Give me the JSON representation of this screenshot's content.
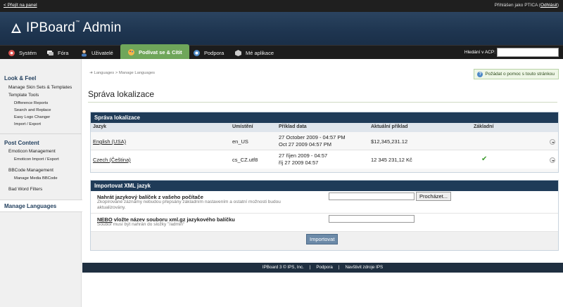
{
  "topbar": {
    "back_link": "< Přejít na panel",
    "login_prefix": "Přihlášen jako PTICA (",
    "logout": "Odhlásit",
    "login_suffix": ")"
  },
  "header": {
    "logo_text": "IPBoard",
    "logo_sup": "™",
    "logo_text2": " Admin"
  },
  "nav": {
    "items": [
      {
        "label": "Systém",
        "icon": "system-icon"
      },
      {
        "label": "Fóra",
        "icon": "forums-icon"
      },
      {
        "label": "Uživatelé",
        "icon": "users-icon"
      },
      {
        "label": "Podívat se & Cítit",
        "icon": "look-feel-icon",
        "active": true
      },
      {
        "label": "Podpora",
        "icon": "support-icon"
      },
      {
        "label": "Mé aplikace",
        "icon": "apps-icon"
      }
    ],
    "search_label": "Hledání v ACP:",
    "search_value": ""
  },
  "sidebar": {
    "section1": "Look & Feel",
    "item_skins": "Manage Skin Sets & Templates",
    "item_tools": "Template Tools",
    "sub_diff": "Difference Reports",
    "sub_search": "Search and Replace",
    "sub_logo": "Easy Logo Changer",
    "sub_import": "Import / Export",
    "section2": "Post Content",
    "item_emoticon": "Emoticon Management",
    "sub_emoticon_ie": "Emoticon Import / Export",
    "item_bbcode": "BBCode Management",
    "sub_media": "Manage Media BBCode",
    "item_badword": "Bad Word Filters",
    "active": "Manage Languages"
  },
  "breadcrumb": {
    "part1": "Languages",
    "sep": ">",
    "part2": "Manage Languages"
  },
  "help_button": "Požádat o pomoc s touto stránkou",
  "page_title": "Správa lokalizace",
  "languages": {
    "heading": "Správa lokalizace",
    "columns": [
      "Jazyk",
      "Umístění",
      "Příklad data",
      "Aktuální příklad",
      "Základní"
    ],
    "rows": [
      {
        "name": "English (USA)",
        "locale": "en_US",
        "date1": "27 October 2009 - 04:57 PM",
        "date2": "Oct 27 2009 04:57 PM",
        "money": "$12,345,231.12",
        "default": ""
      },
      {
        "name": "Czech (Čeština)",
        "locale": "cs_CZ.utf8",
        "date1": "27 říjen 2009 - 04:57",
        "date2": "říj 27 2009 04:57",
        "money": "12 345 231,12 Kč",
        "default": "✔"
      }
    ]
  },
  "import": {
    "heading": "Importovat XML jazyk",
    "upload_label": "Nahrát jazykový balíček z vašeho počítače",
    "upload_desc": "Zkopírované záznamy nebudou přepsány základním nastavením a ostatní možnosti budou aktualizovány.",
    "browse": "Procházet...",
    "or_label": "NEBO",
    "file_label": " vložte název souboru xml.gz jazykového balíčku",
    "file_desc": "Soubor musí být nahrán do složky \"/admin\"",
    "submit": "Importovat"
  },
  "footer": {
    "copyright": "IPBoard 3 © IPS, Inc.",
    "support": "Podpora",
    "visit": "Navštivit zdroje IPS",
    "sep": "|"
  }
}
